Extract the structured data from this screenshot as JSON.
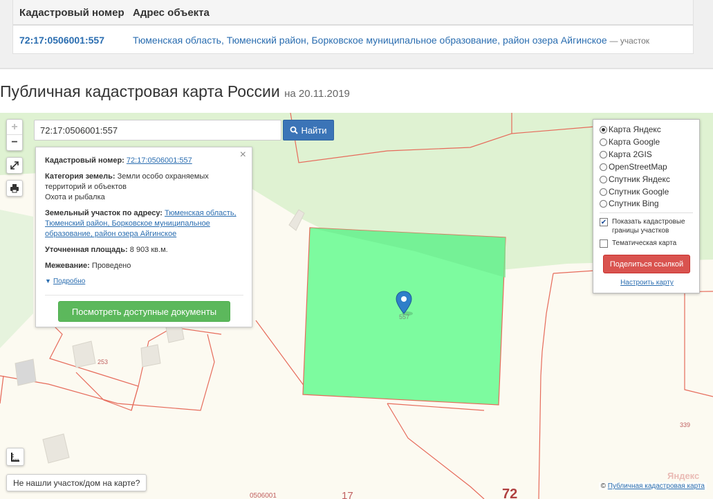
{
  "table": {
    "header_number": "Кадастровый номер",
    "header_address": "Адрес объекта",
    "row_number": "72:17:0506001:557",
    "row_address": "Тюменская область, Тюменский район, Борковское муниципальное образование, район озера Айгинское",
    "row_type": "— участок"
  },
  "page": {
    "title": "Публичная кадастровая карта России",
    "date": "на 20.11.2019"
  },
  "search": {
    "value": "72:17:0506001:557",
    "button_label": "Найти"
  },
  "zoom": {
    "plus": "+",
    "minus": "−"
  },
  "info": {
    "number_label": "Кадастровый номер:",
    "number_value": "72:17:0506001:557",
    "category_label": "Категория земель:",
    "category_value": "Земли особо охраняемых территорий и объектов",
    "category_extra": "Охота и рыбалка",
    "address_label": "Земельный участок по адресу:",
    "address_value": "Тюменская область, Тюменский район, Борковское муниципальное образование, район озера Айгинское",
    "area_label": "Уточненная площадь:",
    "area_value": "8 903 кв.м.",
    "survey_label": "Межевание:",
    "survey_value": "Проведено",
    "more_label": "Подробно",
    "docs_button": "Посмотреть доступные документы",
    "close": "×"
  },
  "layers": {
    "options": [
      "Карта Яндекс",
      "Карта Google",
      "Карта 2GIS",
      "OpenStreetMap",
      "Спутник Яндекс",
      "Спутник Google",
      "Спутник Bing"
    ],
    "selected": "Карта Яндекс",
    "show_borders": "Показать кадастровые границы участков",
    "show_borders_checked": true,
    "thematic": "Тематическая карта",
    "thematic_checked": false,
    "share_button": "Поделиться ссылкой",
    "config_link": "Настроить карту"
  },
  "map_labels": {
    "marker": "557",
    "plot_253": "253",
    "plot_339": "339",
    "quarter": "0506001",
    "label_17": "17",
    "label_72": "72"
  },
  "bottom": {
    "not_found_button": "Не нашли участок/дом на карте?",
    "credit_prefix": "©",
    "credit_link": "Публичная кадастровая карта",
    "yandex": "Яндекс"
  },
  "colors": {
    "parcel_fill": "#7dfb9f",
    "parcel_border": "#e66a5a",
    "forest": "#dff2d2",
    "link": "#2a6db0",
    "primary": "#3b74b7",
    "success": "#5cb85c",
    "danger": "#d9534f"
  },
  "icons": [
    "search-icon",
    "expand-icon",
    "print-icon",
    "ruler-icon",
    "close-icon",
    "caret-down-icon",
    "map-marker-icon"
  ]
}
